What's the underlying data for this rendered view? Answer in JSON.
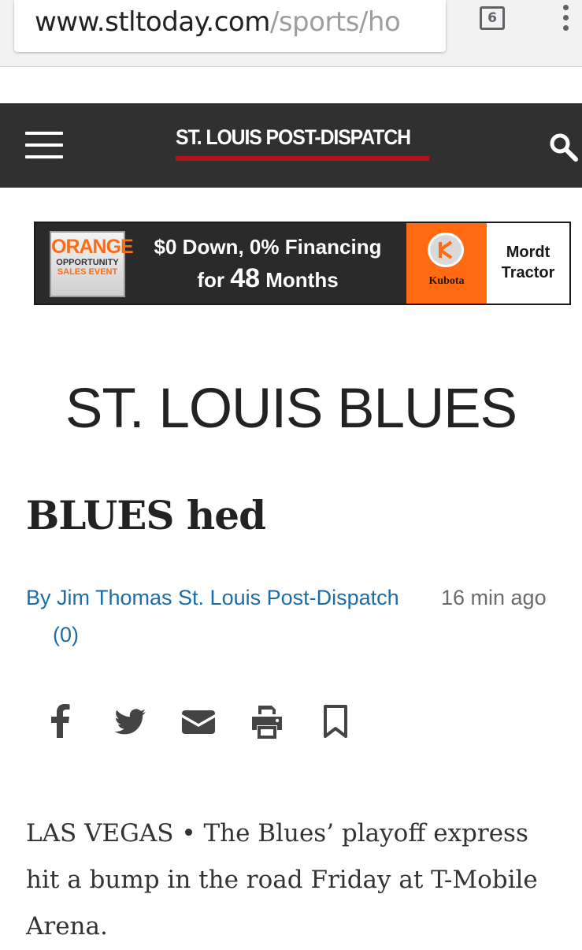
{
  "browser": {
    "url_host": "www.stltoday.com",
    "url_path": "/sports/ho",
    "tab_count": "6",
    "menu_icon": "overflow-menu-icon"
  },
  "site": {
    "logo": "ST. LOUIS POST-DISPATCH",
    "menu_icon": "hamburger-menu-icon",
    "search_icon": "search-icon",
    "colors": {
      "header_bg": "#303030",
      "logo_underline": "#b3121b",
      "link": "#1a6da8"
    }
  },
  "ad": {
    "sign_line1": "ORANGE",
    "sign_line2": "OPPORTUNITY",
    "sign_line3": "SALES EVENT",
    "headline_line1": "$0 Down, 0% Financing",
    "headline_line2_pre": "for ",
    "headline_line2_big": "48",
    "headline_line2_post": " Months",
    "brand": "Kubota",
    "dealer_line1": "Mordt",
    "dealer_line2": "Tractor"
  },
  "article": {
    "section": "ST. LOUIS BLUES",
    "headline": "BLUES hed",
    "byline": "By Jim Thomas St. Louis Post-Dispatch",
    "timestamp": "16 min ago",
    "comments": "(0)",
    "share_icons": [
      "facebook-icon",
      "twitter-icon",
      "email-icon",
      "print-icon",
      "bookmark-icon"
    ],
    "body": "LAS VEGAS • The Blues’ playoff express hit a bump in the road Friday at T-Mobile Arena."
  }
}
